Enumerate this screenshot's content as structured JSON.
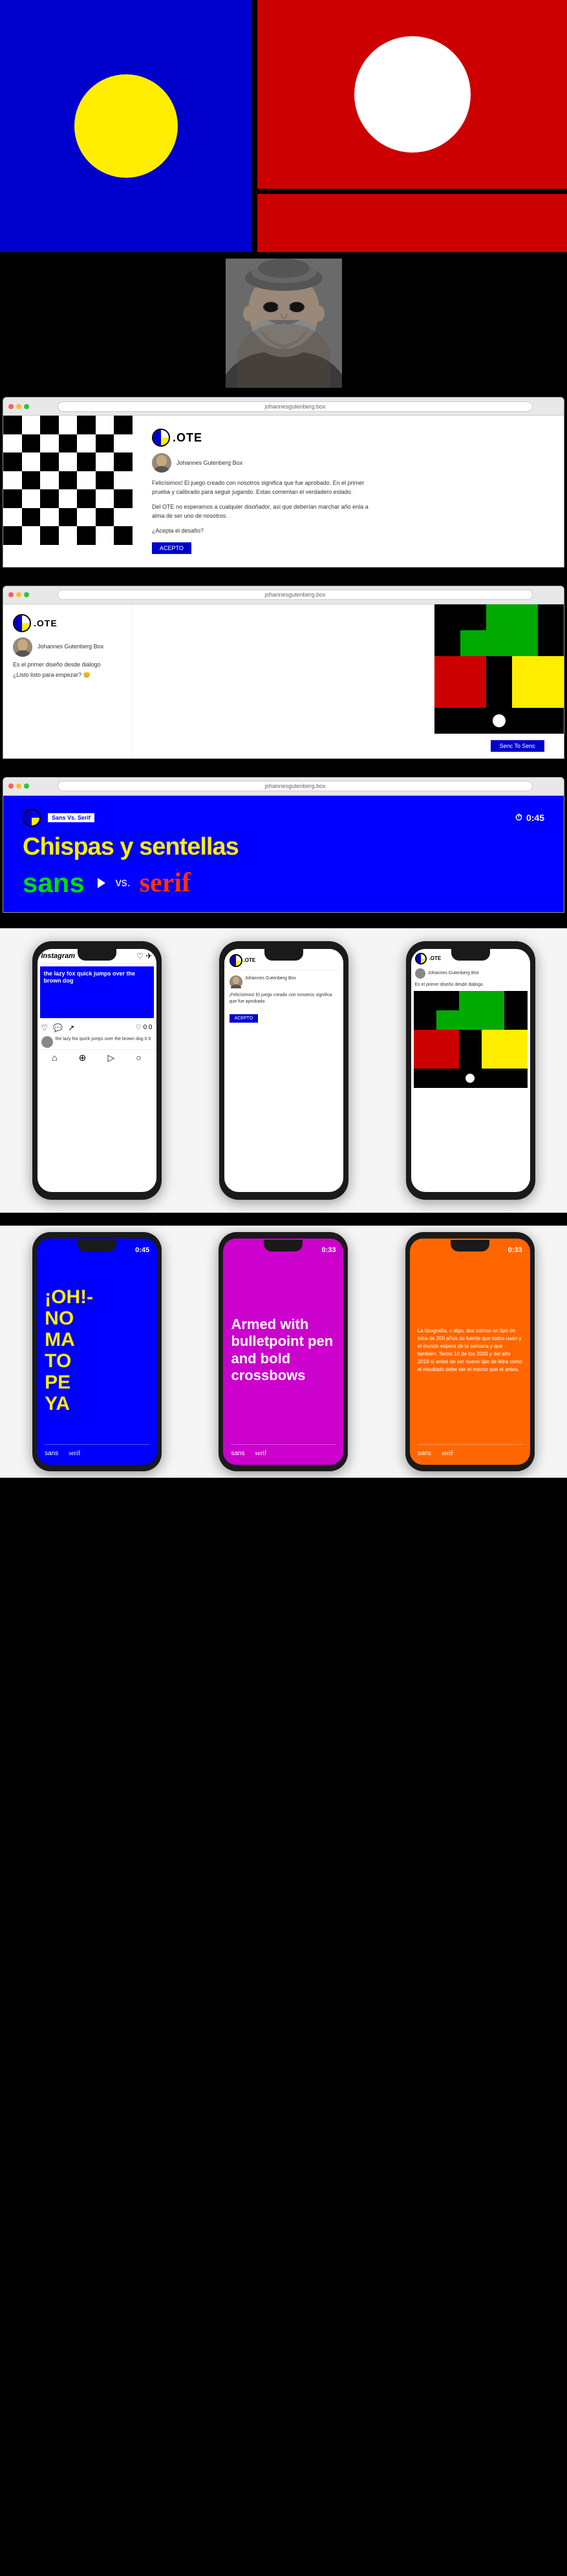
{
  "brand": {
    "name": ".OTE",
    "tagline": "Johannes Gutenberg Box"
  },
  "section1": {
    "type": "mondrian",
    "colors": {
      "blue": "#0000CC",
      "red": "#CC0000",
      "yellow": "#FFEE00",
      "white": "#FFFFFF",
      "black": "#000000"
    }
  },
  "section2": {
    "type": "portrait",
    "description": "Gutenberg portrait with sunglasses"
  },
  "browser1": {
    "url": "johannesgutenberg.box",
    "logo_text": ".OTE",
    "author": "Johannes Gutenberg Box",
    "message_1": "Felicísimos! El juego creado con nosotros significa que fue aprobado. En el primer prueba y calibrado para seguir jugando. Estas comentan el verdadero estado.",
    "message_2": "Del OTE no esperamos a cualquier disoñador, así que deberían marchar año enla a alma de ser uno de nosotros.",
    "question": "¿Acepta el desafío?",
    "btn_aceptar": "ACEPTO"
  },
  "browser2": {
    "url": "johannesgutenberg.box",
    "author_label": "Johannes Gutenberg Box",
    "caption_1": "Es el primer diseño desde diálogo",
    "caption_2": "¿Listo listo para empezar? 😊",
    "btn_send": "Senc To Senc"
  },
  "browser3": {
    "url": "johannesgutenberg.box",
    "tag": "Sans Vs. Serif",
    "timer": "0:45",
    "title": "Chispas y sentellas",
    "sans_label": "sans",
    "vs_label": "vs.",
    "serif_label": "serif"
  },
  "phones_row1": {
    "phone1": {
      "type": "instagram",
      "blue_text": "the lazy fox quick jumps over the brown dog",
      "caption": "the lazy fox quick jumps over the brown dog 0 0",
      "likes": "♡ 0 0",
      "platform": "Instagram"
    },
    "phone2": {
      "type": "message",
      "author": "Johannes Gutenberg Box",
      "content": "¡Felicísimos! El juego creado con nosotros significa que fue aprobado.",
      "btn": "ACEPTO"
    },
    "phone3": {
      "type": "color-grid",
      "author": "Johannes Gutenberg Box",
      "caption": "Es el primer diseño desde diálogo"
    }
  },
  "phones_row2": {
    "phone1": {
      "bg_color": "#0000FF",
      "title_color": "#FFEE00",
      "title": "¡OH!-NO MA TO PE YA",
      "timer": "0:45",
      "sans_label": "sans",
      "serif_label": "serif"
    },
    "phone2": {
      "bg_color": "#CC00CC",
      "title_color": "#FFFFFF",
      "title": "Armed with bulletpoint pen and bold crossbows",
      "timer": "0:33"
    },
    "phone3": {
      "bg_color": "#FF6600",
      "title_color": "#FFFFFF",
      "timer": "0:33",
      "content": "La tipografía, o algo, dos cómos un tipo de letra de 200 años de fuente que todos usan y el mundo espera de la semana y que también. Tecno 10 de los 2000 y del año 2019 si antes de ser nuevo tipo de letra como el resultado debe ser el mismo que el antes."
    }
  },
  "labels": {
    "sans": "sans",
    "serif": "serif"
  }
}
